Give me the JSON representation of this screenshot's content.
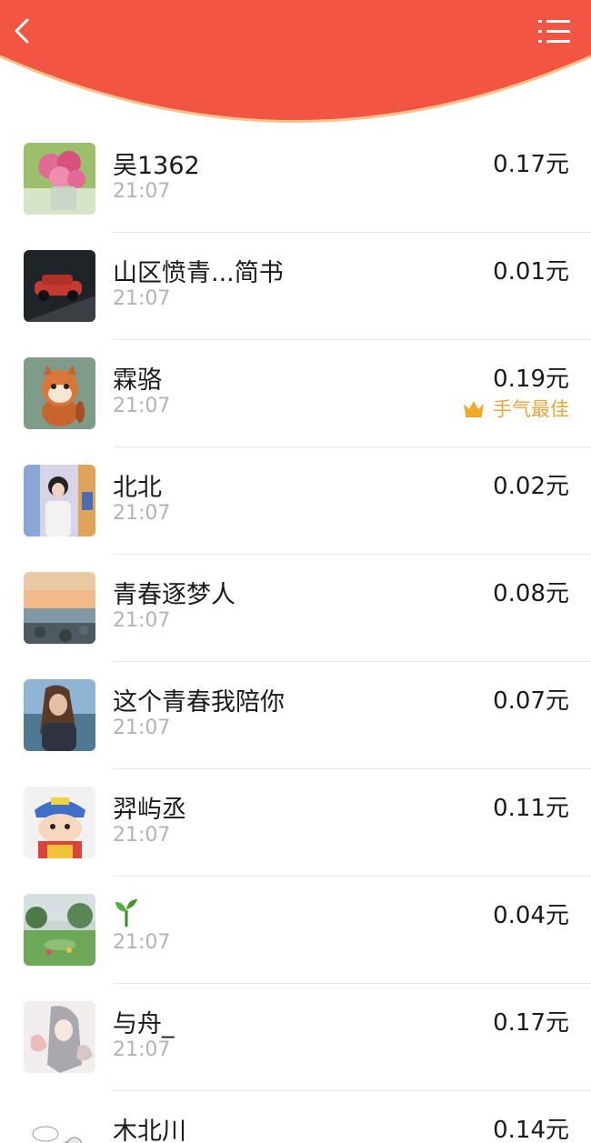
{
  "header": {
    "bg_color": "#f25543",
    "rim_color": "#f0c48a",
    "back_icon": "chevron-left-icon",
    "menu_icon": "list-menu-icon"
  },
  "currency_suffix": "元",
  "best_label": "手气最佳",
  "colors": {
    "best": "#e9a53a",
    "time": "#b3b3b3"
  },
  "records": [
    {
      "name": "吴1362",
      "time": "21:07",
      "amount": "0.17元",
      "avatar": "pink-flowers"
    },
    {
      "name": "山区愤青...简书",
      "time": "21:07",
      "amount": "0.01元",
      "avatar": "red-suv"
    },
    {
      "name": "霖骆",
      "time": "21:07",
      "amount": "0.19元",
      "avatar": "red-panda-cartoon",
      "best": true
    },
    {
      "name": "北北",
      "time": "21:07",
      "amount": "0.02元",
      "avatar": "girl-colorful-wall"
    },
    {
      "name": "青春逐梦人",
      "time": "21:07",
      "amount": "0.08元",
      "avatar": "sea-sunset"
    },
    {
      "name": "这个青春我陪你",
      "time": "21:07",
      "amount": "0.07元",
      "avatar": "girl-by-sea"
    },
    {
      "name": "羿屿丞",
      "time": "21:07",
      "amount": "0.11元",
      "avatar": "crayon-shin-chan"
    },
    {
      "name": "🌱",
      "time": "21:07",
      "amount": "0.04元",
      "avatar": "garden-park",
      "name_is_icon": true
    },
    {
      "name": "与舟_",
      "time": "21:07",
      "amount": "0.17元",
      "avatar": "anime-sketch"
    },
    {
      "name": "木北川",
      "time": "",
      "amount": "0.14元",
      "avatar": "cartoon-sketch"
    }
  ]
}
